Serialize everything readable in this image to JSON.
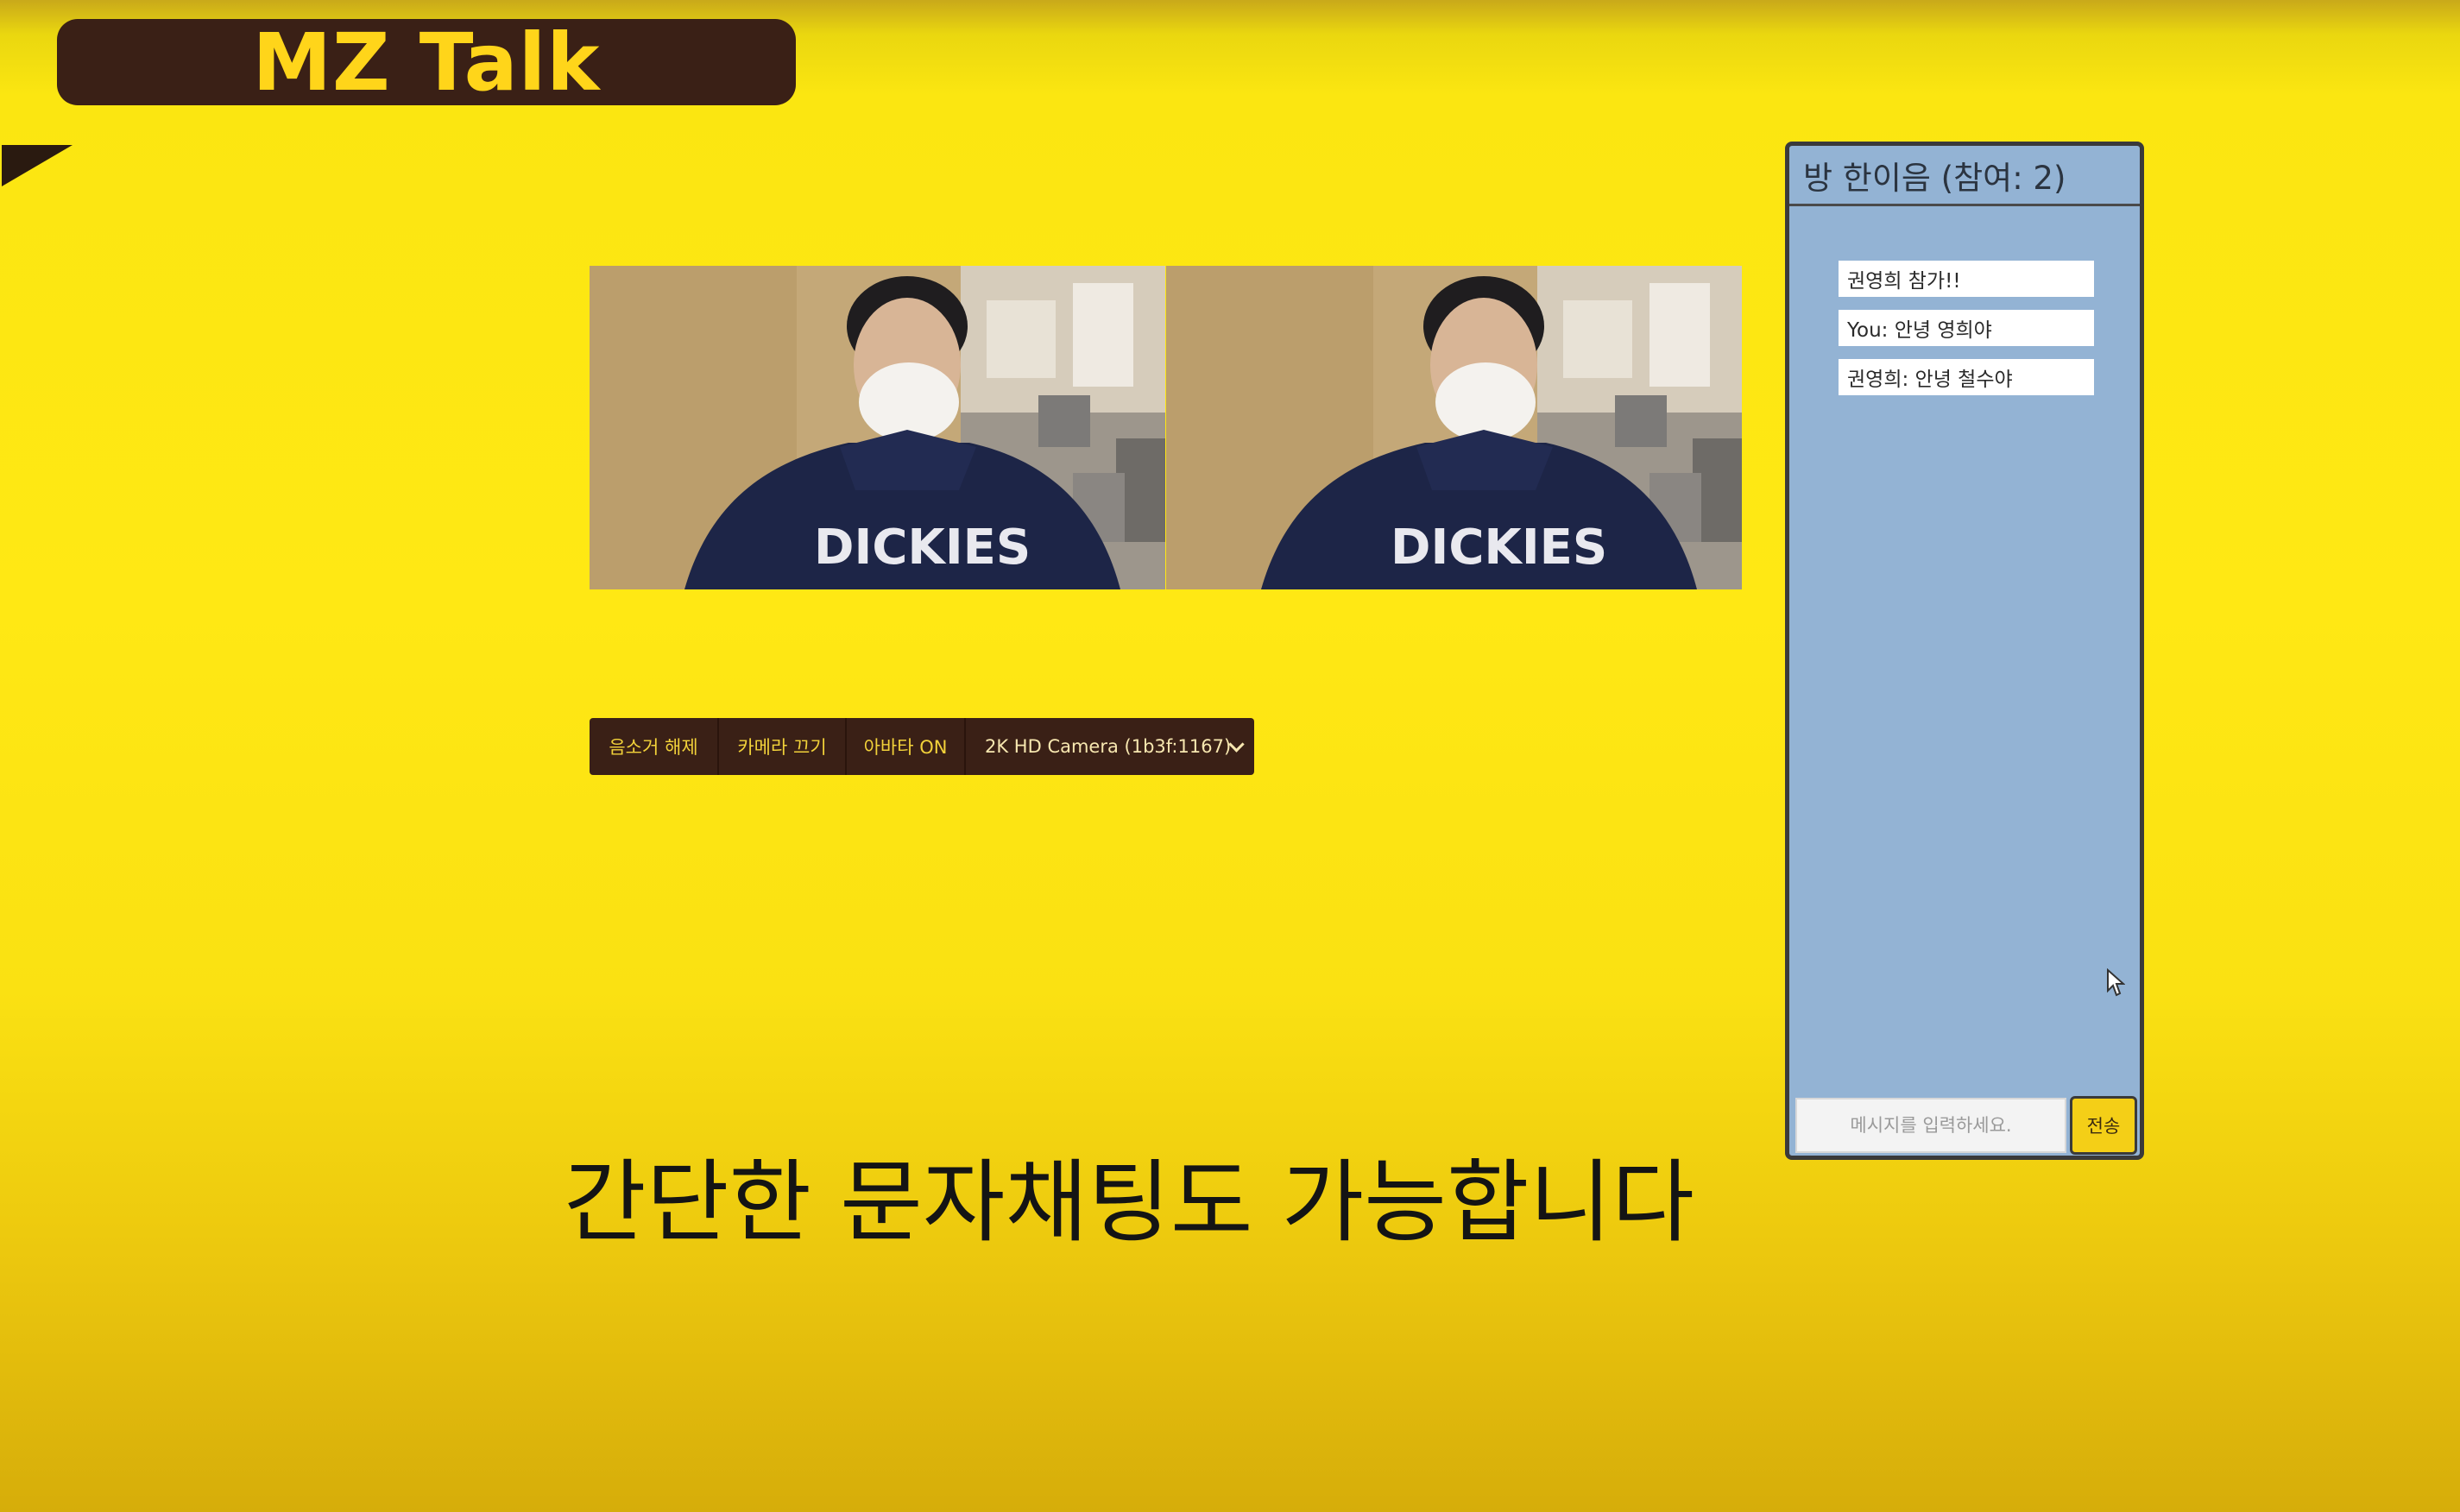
{
  "header": {
    "app_title": "MZ Talk"
  },
  "videos": [
    {
      "name": "local-video",
      "shirt_text": "DICKIES"
    },
    {
      "name": "remote-video",
      "shirt_text": "DICKIES"
    }
  ],
  "controls": {
    "mute_label": "음소거 해제",
    "camera_label": "카메라 끄기",
    "avatar_label": "아바타 ON",
    "camera_select_value": "2K HD Camera (1b3f:1167)"
  },
  "chat": {
    "header": "방 한이음 (참여: 2)",
    "messages": [
      "권영희 참가!!",
      "You: 안녕 영희야",
      "권영희: 안녕 철수야"
    ],
    "input_placeholder": "메시지를 입력하세요.",
    "send_label": "전송"
  },
  "subtitle": "간단한 문자채팅도 가능합니다",
  "colors": {
    "background": "#ffe814",
    "dark_brown": "#3a2016",
    "accent_yellow": "#ffd51a",
    "chat_panel": "#93b3d4",
    "send_button": "#f4cf17"
  }
}
